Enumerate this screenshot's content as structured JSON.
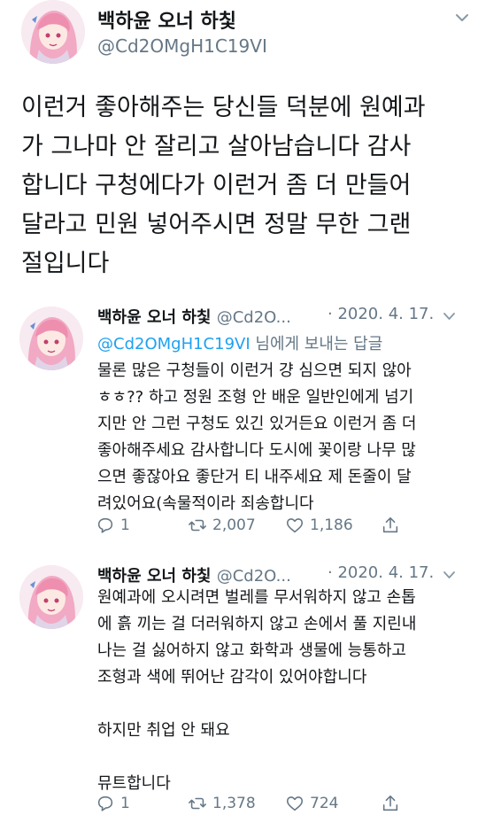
{
  "main_tweet": {
    "display_name": "백하윤 오너 하칯",
    "handle": "@Cd2OMgH1C19VI",
    "text_lines": [
      "이런거 좋아해주는 당신들 덕분에 원예과",
      "가 그나마 안 잘리고 살아남습니다 감사",
      "합니다 구청에다가 이런거 좀 더 만들어",
      "달라고 민원 넣어주시면 정말 무한 그랜",
      "절입니다"
    ]
  },
  "reply1": {
    "display_name": "백하윤 오너 하칯",
    "handle": "@Cd2O...",
    "date": "· 2020. 4. 17.",
    "replying_mention": "@Cd2OMgH1C19VI",
    "replying_suffix": " 님에게 보내는 답글",
    "text_lines": [
      "물론 많은 구청들이 이런거 걍 심으면 되지 않아",
      "ㅎㅎ?? 하고 정원 조형 안 배운 일반인에게 넘기",
      "지만 안 그런 구청도 있긴 있거든요 이런거 좀 더",
      "좋아해주세요 감사합니다 도시에 꽃이랑 나무 많",
      "으면 좋잖아요 좋단거 티 내주세요 제 돈줄이 달",
      "려있어요(속물적이라 죄송합니다"
    ],
    "reply_count": "1",
    "retweet_count": "2,007",
    "like_count": "1,186"
  },
  "reply2": {
    "display_name": "백하윤 오너 하칯",
    "handle": "@Cd2O...",
    "date": "· 2020. 4. 17.",
    "text_lines_a": [
      "원예과에 오시려면 벌레를 무서워하지 않고 손톱",
      "에 흙 끼는 걸 더러워하지 않고 손에서 풀 지린내",
      "나는 걸 싫어하지 않고 화학과 생물에 능통하고",
      "조형과 색에 뛰어난 감각이 있어야합니다"
    ],
    "text_line_b": "하지만 취업 안 돼요",
    "text_line_c": "뮤트합니다",
    "reply_count": "1",
    "retweet_count": "1,378",
    "like_count": "724"
  },
  "icons": {
    "reply": "reply-icon",
    "retweet": "retweet-icon",
    "like": "heart-icon",
    "share": "share-icon",
    "more": "chevron-down-icon"
  },
  "colors": {
    "text": "#14171a",
    "secondary": "#657786",
    "link": "#1da1f2"
  }
}
